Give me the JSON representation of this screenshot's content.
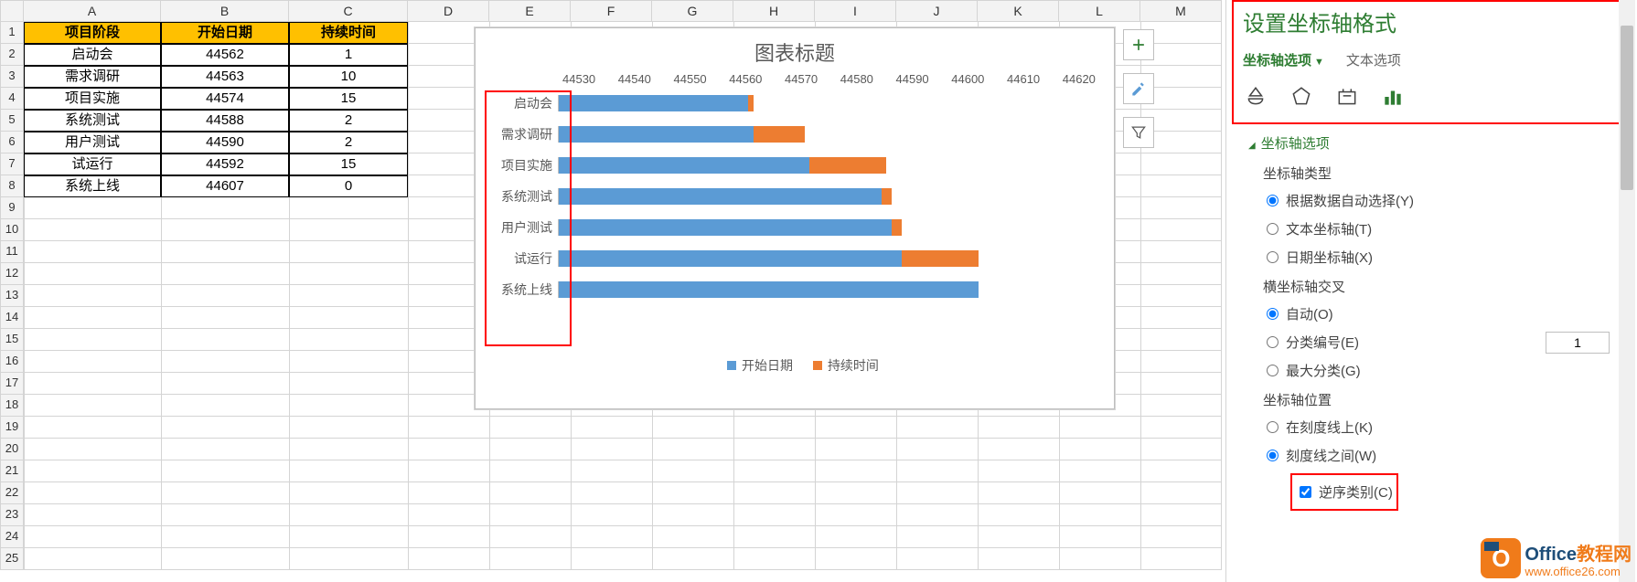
{
  "columns": [
    "A",
    "B",
    "C",
    "D",
    "E",
    "F",
    "G",
    "H",
    "I",
    "J",
    "K",
    "L",
    "M"
  ],
  "table": {
    "headers": [
      "项目阶段",
      "开始日期",
      "持续时间"
    ],
    "rows": [
      {
        "phase": "启动会",
        "start": "44562",
        "dur": "1"
      },
      {
        "phase": "需求调研",
        "start": "44563",
        "dur": "10"
      },
      {
        "phase": "项目实施",
        "start": "44574",
        "dur": "15"
      },
      {
        "phase": "系统测试",
        "start": "44588",
        "dur": "2"
      },
      {
        "phase": "用户测试",
        "start": "44590",
        "dur": "2"
      },
      {
        "phase": "试运行",
        "start": "44592",
        "dur": "15"
      },
      {
        "phase": "系统上线",
        "start": "44607",
        "dur": "0"
      }
    ]
  },
  "chart_data": {
    "type": "bar",
    "orientation": "horizontal",
    "stacked": true,
    "title": "图表标题",
    "categories": [
      "启动会",
      "需求调研",
      "项目实施",
      "系统测试",
      "用户测试",
      "试运行",
      "系统上线"
    ],
    "series": [
      {
        "name": "开始日期",
        "color": "#5b9bd5",
        "values": [
          44562,
          44563,
          44574,
          44588,
          44590,
          44592,
          44607
        ]
      },
      {
        "name": "持续时间",
        "color": "#ed7d31",
        "values": [
          1,
          10,
          15,
          2,
          2,
          15,
          0
        ]
      }
    ],
    "x_ticks": [
      44530,
      44540,
      44550,
      44560,
      44570,
      44580,
      44590,
      44600,
      44610,
      44620
    ],
    "xlim": [
      44525,
      44625
    ]
  },
  "chart_buttons": {
    "add": "+",
    "style": "brush",
    "filter": "funnel"
  },
  "pane": {
    "title": "设置坐标轴格式",
    "tab_axis": "坐标轴选项",
    "tab_text": "文本选项",
    "section": "坐标轴选项",
    "axis_type_label": "坐标轴类型",
    "axis_type_opts": {
      "auto": "根据数据自动选择(Y)",
      "text": "文本坐标轴(T)",
      "date": "日期坐标轴(X)"
    },
    "cross_label": "横坐标轴交叉",
    "cross_opts": {
      "auto": "自动(O)",
      "catnum": "分类编号(E)",
      "maxcat": "最大分类(G)"
    },
    "catnum_value": "1",
    "pos_label": "坐标轴位置",
    "pos_opts": {
      "ontick": "在刻度线上(K)",
      "between": "刻度线之间(W)"
    },
    "reverse_label": "逆序类别(C)"
  },
  "logo": {
    "l1": "Office",
    "l2": "教程网",
    "sub": "www.office26.com"
  }
}
